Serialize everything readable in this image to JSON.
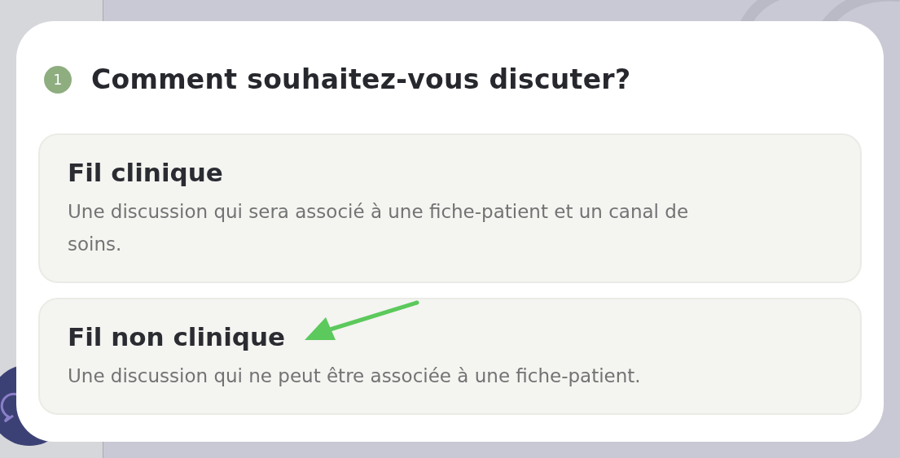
{
  "dialog": {
    "step": "1",
    "title": "Comment souhaitez-vous discuter?",
    "options": [
      {
        "title": "Fil clinique",
        "description": "Une discussion qui sera associé à une fiche-patient et un canal de soins."
      },
      {
        "title": "Fil non clinique",
        "description": "Une discussion qui ne peut être associée à une fiche-patient."
      }
    ]
  }
}
